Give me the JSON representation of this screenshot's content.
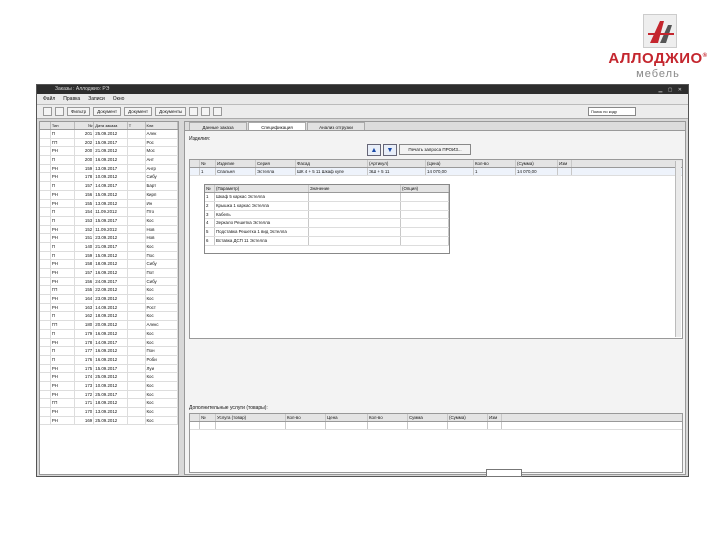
{
  "logo": {
    "brand": "АЛЛОДЖИО",
    "sub": "мебель",
    "reg": "®"
  },
  "window": {
    "title": "Заказы : Аллоджио: РЭ",
    "controls": "▁ ▢ ✕"
  },
  "menu": [
    "Файл",
    "Правка",
    "Записи",
    "Окно"
  ],
  "toolbar": {
    "btn1": "Фильтр",
    "btn2": "Документ",
    "btn3": "Документ",
    "btn4": "Документы",
    "search": "Поиск по коду"
  },
  "left_headers": [
    "Тип",
    "№",
    "Дата заказа",
    "Т",
    "Кли"
  ],
  "left_rows": [
    [
      "П",
      "201",
      "25.09.2012",
      "Алек"
    ],
    [
      "ГП",
      "202",
      "15.09.2017",
      "Рос"
    ],
    [
      "РН",
      "200",
      "21.09.2012",
      "Мос"
    ],
    [
      "П",
      "200",
      "16.09.2012",
      "Ант"
    ],
    [
      "РН",
      "159",
      "13.09.2017",
      "Ангр"
    ],
    [
      "РН",
      "178",
      "10.09.2012",
      "Сибу"
    ],
    [
      "П",
      "157",
      "14.09.2017",
      "Барт"
    ],
    [
      "РН",
      "156",
      "15.09.2012",
      "Кирп"
    ],
    [
      "РН",
      "155",
      "13.09.2012",
      "Ин"
    ],
    [
      "П",
      "154",
      "11.09.2012",
      "Пто"
    ],
    [
      "П",
      "153",
      "15.09.2017",
      "Кос"
    ],
    [
      "РН",
      "152",
      "11.09.2012",
      "Нов"
    ],
    [
      "РН",
      "151",
      "23.09.2012",
      "Нов"
    ],
    [
      "П",
      "140",
      "21.09.2017",
      "Кос"
    ],
    [
      "П",
      "159",
      "15.09.2012",
      "Пос"
    ],
    [
      "РН",
      "158",
      "18.09.2012",
      "Сибу"
    ],
    [
      "РН",
      "157",
      "16.09.2012",
      "Пот"
    ],
    [
      "РН",
      "156",
      "24.09.2017",
      "Сибу"
    ],
    [
      "ГП",
      "155",
      "22.09.2012",
      "Кос"
    ],
    [
      "РН",
      "164",
      "23.09.2012",
      "Кос"
    ],
    [
      "РН",
      "163",
      "14.09.2012",
      "Рост"
    ],
    [
      "П",
      "162",
      "18.09.2012",
      "Кос"
    ],
    [
      "ГП",
      "180",
      "20.09.2012",
      "Алекс"
    ],
    [
      "П",
      "179",
      "16.09.2012",
      "Кос"
    ],
    [
      "РН",
      "178",
      "14.09.2017",
      "Кос"
    ],
    [
      "П",
      "177",
      "16.09.2012",
      "Пон"
    ],
    [
      "П",
      "176",
      "16.09.2012",
      "Роби"
    ],
    [
      "РН",
      "175",
      "15.09.2017",
      "Луи"
    ],
    [
      "РН",
      "174",
      "25.09.2012",
      "Кос"
    ],
    [
      "РН",
      "173",
      "10.09.2012",
      "Кос"
    ],
    [
      "РН",
      "172",
      "25.09.2017",
      "Кос"
    ],
    [
      "ГП",
      "171",
      "18.09.2012",
      "Кос"
    ],
    [
      "РН",
      "170",
      "13.09.2012",
      "Кос"
    ],
    [
      "РН",
      "169",
      "25.09.2012",
      "Кос"
    ]
  ],
  "tabs": [
    "Данные заказа",
    "Спецификация",
    "Анализ отгрузки"
  ],
  "items_label": "Изделия:",
  "print_button": "Печать запроса ПРОИЗ...",
  "grid1_headers": [
    "",
    "№",
    "Изделие",
    "Серия",
    "Фасад",
    "(Артикул)",
    "(Цена)",
    "Кол-во",
    "(Сумма)",
    "Изм"
  ],
  "grid1_rows": [
    [
      "",
      "1",
      "Спальня",
      "Эстелла",
      "ШК 4 + 5 11 Шкаф купе",
      "ЭШ + 5 11",
      "14 070,00",
      "1",
      "14 070,00",
      ""
    ]
  ],
  "nested_headers": [
    "№",
    "(Параметр)",
    "Значение",
    "(Опция)"
  ],
  "nested_rows": [
    [
      "1",
      "Шкаф 5 каркас Эстелла",
      "",
      ""
    ],
    [
      "2",
      "Крышка 1 каркас Эстелла",
      "",
      ""
    ],
    [
      "3",
      "Кабель",
      "",
      ""
    ],
    [
      "4",
      "Зеркало Решетка Эстелла",
      "",
      ""
    ],
    [
      "5",
      "Подставка Решетка 1 вид Эстелла",
      "",
      ""
    ],
    [
      "6",
      "Вставка ДСП 11 Эстелла",
      "",
      ""
    ]
  ],
  "extra_label": "Дополнительные услуги (товары):",
  "grid2_headers": [
    "",
    "№",
    "Услуга (товар)",
    "Кол-во",
    "Цена",
    "Кол-во",
    "Сумма",
    "(Сумма)",
    "Изм"
  ]
}
